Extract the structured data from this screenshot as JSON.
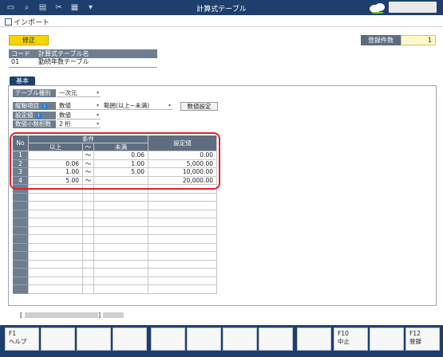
{
  "window": {
    "title": "計算式テーブル"
  },
  "toolbar": {
    "import_label": "インポート"
  },
  "status": {
    "badge": "修正"
  },
  "record_count": {
    "label": "登録件数",
    "value": "1"
  },
  "code_table": {
    "col_code": "コード",
    "col_name": "計算式テーブル名",
    "code": "01",
    "name": "勤続年数テーブル"
  },
  "tab": {
    "label": "基本"
  },
  "form": {
    "table_type": {
      "label": "テーブル種別",
      "value": "一次元"
    },
    "vertical_item": {
      "label": "縦軸項目",
      "value": "数値",
      "range": "範囲(以上~未満)"
    },
    "setting_value": {
      "label": "設定値",
      "value": "数値"
    },
    "decimal_places": {
      "label": "数値小数桁数",
      "value": "2 桁"
    },
    "numeric_settings_button": "数値設定"
  },
  "grid": {
    "col_no": "No",
    "col_condition": "条件",
    "col_min": "以上",
    "col_tilde": "～",
    "col_max": "未満",
    "col_setting": "設定値",
    "rows": [
      {
        "no": "1",
        "min": "",
        "tilde": "～",
        "max": "0.06",
        "value": "0.00"
      },
      {
        "no": "2",
        "min": "0.06",
        "tilde": "～",
        "max": "1.00",
        "value": "5,000.00"
      },
      {
        "no": "3",
        "min": "1.00",
        "tilde": "～",
        "max": "5.00",
        "value": "10,000.00"
      },
      {
        "no": "4",
        "min": "5.00",
        "tilde": "～",
        "max": "",
        "value": "20,000.00"
      }
    ],
    "empty_rows": 13
  },
  "footer": {
    "bracket_open": "[",
    "bracket_close": "]",
    "keys": [
      {
        "label": "F1",
        "sub": "ヘルプ"
      },
      {
        "label": "",
        "sub": ""
      },
      {
        "label": "",
        "sub": ""
      },
      {
        "label": "",
        "sub": ""
      },
      {
        "label": "",
        "sub": ""
      },
      {
        "label": "",
        "sub": ""
      },
      {
        "label": "",
        "sub": ""
      },
      {
        "label": "",
        "sub": ""
      },
      {
        "label": "",
        "sub": ""
      },
      {
        "label": "F10",
        "sub": "中止"
      },
      {
        "label": "",
        "sub": ""
      },
      {
        "label": "F12",
        "sub": "登録"
      }
    ]
  },
  "icons": [
    "window-icon",
    "search-doc-icon",
    "print-icon",
    "scissors-icon",
    "excel-icon",
    "dropdown-menu-icon",
    "cloud-logo-icon",
    "import-icon",
    "info-icon"
  ],
  "colors": {
    "titlebar": "#1e3f6e",
    "badge": "#f5d400",
    "highlight_box": "#e2202b",
    "header": "#6f7e8f"
  }
}
